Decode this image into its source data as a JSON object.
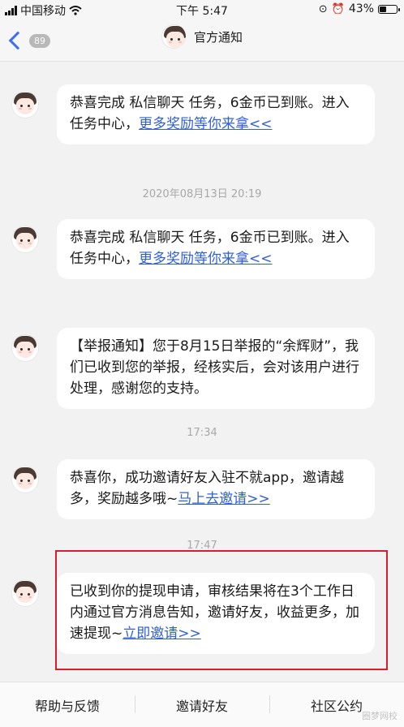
{
  "status_bar": {
    "carrier": "中国移动",
    "time": "下午 5:47",
    "battery": "43%",
    "battery_level": 0.43
  },
  "nav": {
    "back_count": "89",
    "title": "官方通知"
  },
  "messages": [
    {
      "prefix": "恭喜完成 私信聊天 任务，6金币已到账。进入任务中心，",
      "link": "更多奖励等你来拿<<"
    },
    {
      "prefix": "恭喜完成 私信聊天 任务，6金币已到账。进入任务中心，",
      "link": "更多奖励等你来拿<<"
    },
    {
      "prefix": "【举报通知】您于8月15日举报的“余辉财”，我们已收到您的举报，经核实后，会对该用户进行处理，感谢您的支持。",
      "link": ""
    },
    {
      "prefix": "恭喜你，成功邀请好友入驻不就app，邀请越多，奖励越多哦~",
      "link": "马上去邀请>>"
    },
    {
      "prefix": "已收到你的提现申请，审核结果将在3个工作日内通过官方消息告知，邀请好友，收益更多，加速提现~",
      "link": "立即邀请>>"
    }
  ],
  "timestamps": [
    "2020年08月13日 20:19",
    "17:34",
    "17:47"
  ],
  "tabs": [
    "帮助与反馈",
    "邀请好友",
    "社区公约"
  ],
  "watermark": "圈梦网校",
  "colors": {
    "link": "#2f5fd8",
    "highlight": "#d81e2a",
    "back": "#3b6ef5"
  }
}
